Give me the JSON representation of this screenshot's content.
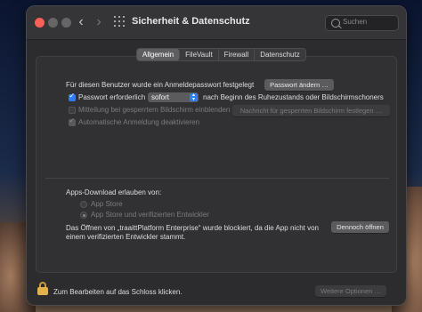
{
  "window": {
    "title": "Sicherheit & Datenschutz",
    "search_placeholder": "Suchen"
  },
  "icons": {
    "back": "chevron-left-icon",
    "forward": "chevron-right-icon",
    "grid": "grid-icon",
    "search": "search-icon",
    "lock": "lock-icon"
  },
  "tabs": [
    {
      "label": "Allgemein",
      "active": true
    },
    {
      "label": "FileVault",
      "active": false
    },
    {
      "label": "Firewall",
      "active": false
    },
    {
      "label": "Datenschutz",
      "active": false
    }
  ],
  "general": {
    "password_set_text": "Für diesen Benutzer wurde ein Anmeldepasswort festgelegt",
    "change_password_button": "Passwort ändern …",
    "require_password_label": "Passwort erforderlich",
    "require_password_checked": true,
    "require_password_value": "sofort",
    "require_password_suffix": "nach Beginn des Ruhezustands oder Bildschirmschoners",
    "lock_message_label": "Mitteilung bei gesperrtem Bildschirm einblenden",
    "lock_message_button": "Nachricht für gesperrten Bildschirm festlegen …",
    "auto_login_label": "Automatische Anmeldung deaktivieren"
  },
  "downloads": {
    "heading": "Apps-Download erlauben von:",
    "option_app_store": "App Store",
    "option_identified": "App Store und verifizierten Entwickler",
    "blocked_message_line1": "Das Öffnen von „traaittPlatform Enterprise“ wurde blockiert, da die App nicht von",
    "blocked_message_line2": "einem verifizierten Entwickler stammt.",
    "open_anyway_button": "Dennoch öffnen"
  },
  "footer": {
    "lock_text": "Zum Bearbeiten auf das Schloss klicken.",
    "advanced_button": "Weitere Optionen …"
  },
  "colors": {
    "close": "#ff5f57",
    "accent": "#2f7cf6",
    "lock": "#e4b24a"
  }
}
